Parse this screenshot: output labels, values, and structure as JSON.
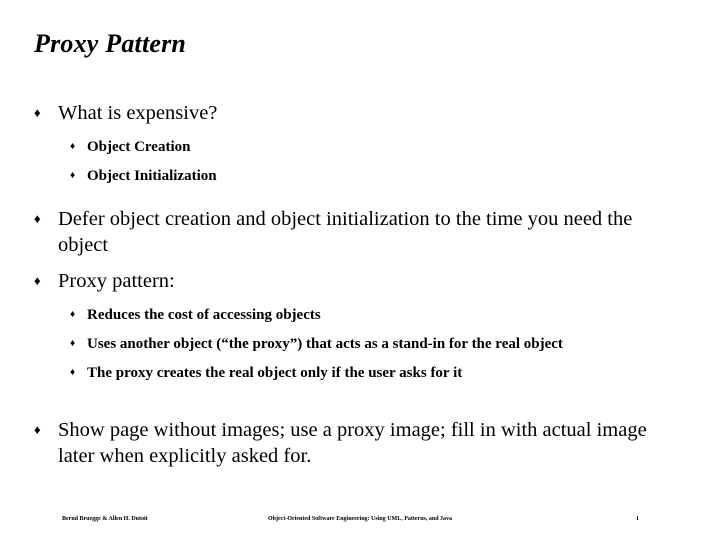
{
  "slide": {
    "title": "Proxy Pattern",
    "bullet_marker": "♦",
    "sub_bullet_marker": "♦",
    "text_color": "#000000",
    "background_color": "#ffffff",
    "items": [
      {
        "level": 1,
        "text": "What is expensive?"
      },
      {
        "level": 2,
        "text": "Object Creation"
      },
      {
        "level": 2,
        "text": "Object Initialization"
      },
      {
        "level": 1,
        "text": "Defer object creation and object initialization to the time you need the object"
      },
      {
        "level": 1,
        "text": "Proxy pattern:"
      },
      {
        "level": 2,
        "text": "Reduces the cost of accessing objects"
      },
      {
        "level": 2,
        "text": "Uses another object (“the proxy”) that acts as a stand-in for the real object"
      },
      {
        "level": 2,
        "text": "The proxy creates the real object only if the user asks for it"
      },
      {
        "level": 1,
        "text": "Show page without images; use a proxy image; fill in with actual image later when explicitly asked for."
      }
    ]
  },
  "footer": {
    "authors": "Bernd Bruegge & Allen H. Dutoit",
    "book_title": "Object-Oriented Software Engineering: Using UML, Patterns, and Java",
    "page_number": "1"
  }
}
